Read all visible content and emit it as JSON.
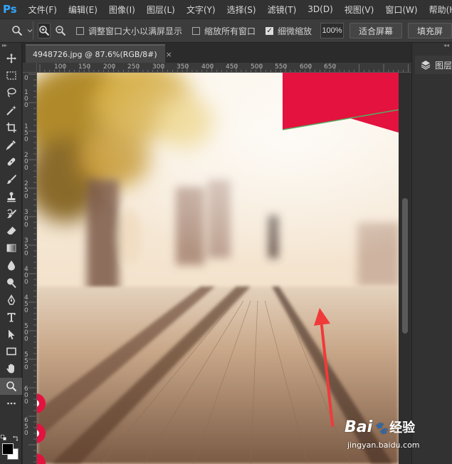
{
  "app": {
    "logo": "Ps",
    "menus": [
      "文件(F)",
      "编辑(E)",
      "图像(I)",
      "图层(L)",
      "文字(Y)",
      "选择(S)",
      "滤镜(T)",
      "3D(D)",
      "视图(V)",
      "窗口(W)",
      "帮助(H)"
    ]
  },
  "options": {
    "resize_windows_label": "调整窗口大小以满屏显示",
    "resize_windows_checked": false,
    "zoom_all_label": "缩放所有窗口",
    "zoom_all_checked": false,
    "scrubby_label": "细微缩放",
    "scrubby_checked": true,
    "zoom_value": "100%",
    "fit_screen_label": "适合屏幕",
    "fill_screen_label": "填充屏"
  },
  "document": {
    "tab_title": "4948726.jpg @ 87.6%(RGB/8#)",
    "tab_close": "×",
    "ruler_h": [
      "100",
      "150",
      "200",
      "250",
      "300",
      "350",
      "400",
      "450",
      "500",
      "550",
      "600",
      "650"
    ],
    "ruler_v": [
      "0",
      "1 0 0",
      "1 5 0",
      "2 0 0",
      "2 5 0",
      "3 0 0",
      "3 5 0",
      "4 0 0",
      "4 5 0",
      "5 0 0",
      "5 5 0",
      "6 0 0",
      "6 5 0"
    ]
  },
  "right_panel": {
    "layers_label": "图层"
  },
  "watermark": {
    "brand": "Bai",
    "brand_mid": "经验",
    "url": "jingyan.baidu.com"
  },
  "colors": {
    "accent": "#31a8ff",
    "arrow": "#f03a3a",
    "banner": "#e3123f"
  }
}
